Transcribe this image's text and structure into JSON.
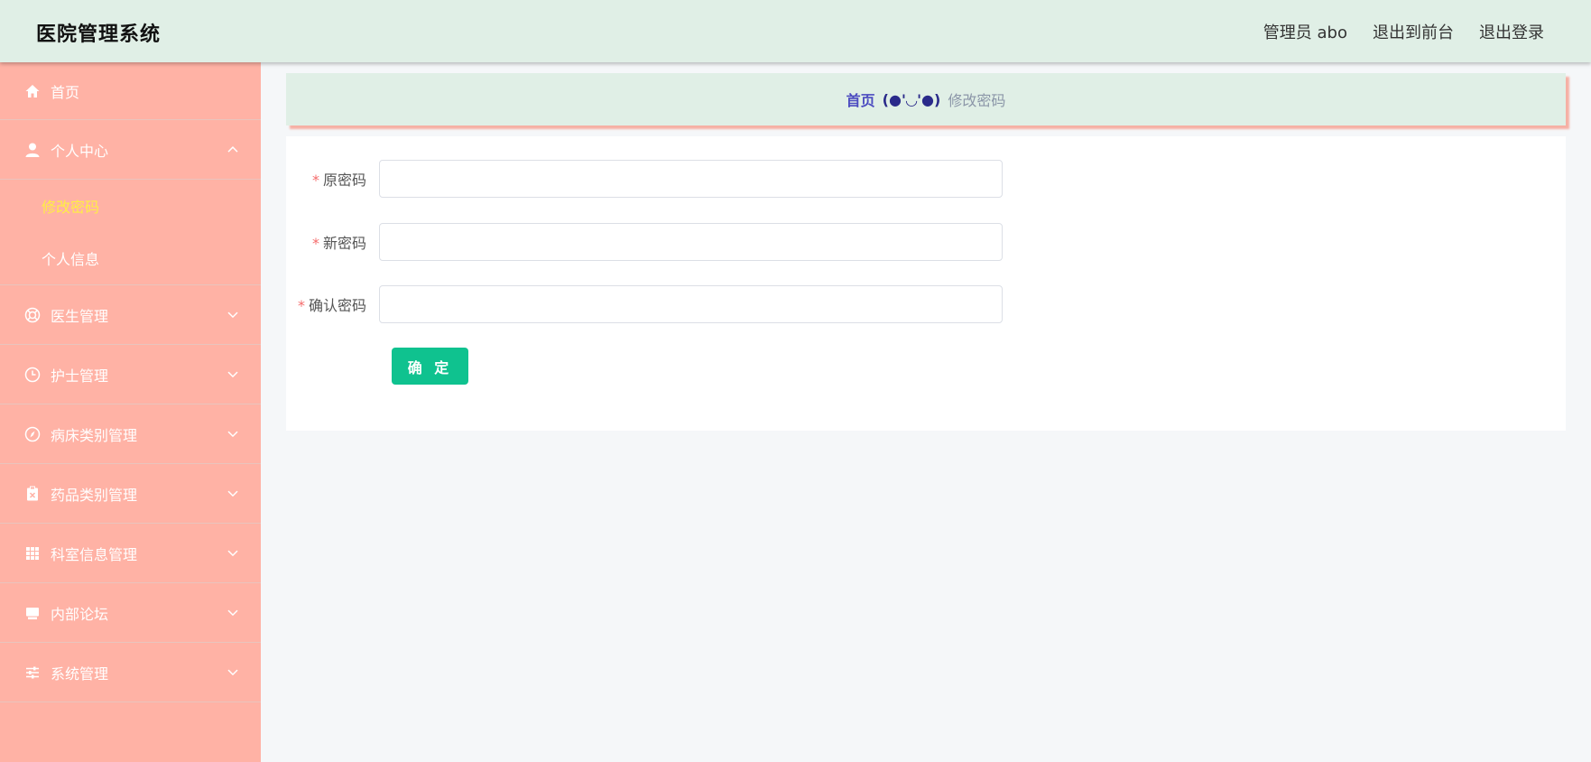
{
  "header": {
    "title": "医院管理系统",
    "admin_label": "管理员 abo",
    "to_front": "退出到前台",
    "logout": "退出登录"
  },
  "sidebar": {
    "items": [
      {
        "label": "首页",
        "icon": "home-icon"
      },
      {
        "label": "个人中心",
        "icon": "user-icon",
        "expanded": true,
        "children": [
          {
            "label": "修改密码",
            "active": true
          },
          {
            "label": "个人信息",
            "active": false
          }
        ]
      },
      {
        "label": "医生管理",
        "icon": "lifebuoy-icon"
      },
      {
        "label": "护士管理",
        "icon": "clock-icon"
      },
      {
        "label": "病床类别管理",
        "icon": "compass-icon"
      },
      {
        "label": "药品类别管理",
        "icon": "clipboard-icon"
      },
      {
        "label": "科室信息管理",
        "icon": "grid-icon"
      },
      {
        "label": "内部论坛",
        "icon": "monitor-icon"
      },
      {
        "label": "系统管理",
        "icon": "sliders-icon"
      }
    ]
  },
  "breadcrumb": {
    "home": "首页",
    "separator": "(●'◡'●)",
    "current": "修改密码"
  },
  "form": {
    "required_mark": "*",
    "fields": [
      {
        "label": "原密码",
        "value": "",
        "placeholder": ""
      },
      {
        "label": "新密码",
        "value": "",
        "placeholder": ""
      },
      {
        "label": "确认密码",
        "value": "",
        "placeholder": ""
      }
    ],
    "submit_label": "确 定"
  },
  "colors": {
    "header_bg": "#e0efe6",
    "sidebar_bg": "#ffb2a5",
    "active_submenu": "#ffee44",
    "breadcrumb_home": "#4b4bc0",
    "button_bg": "#0fc28f",
    "required": "#f56c6c"
  }
}
